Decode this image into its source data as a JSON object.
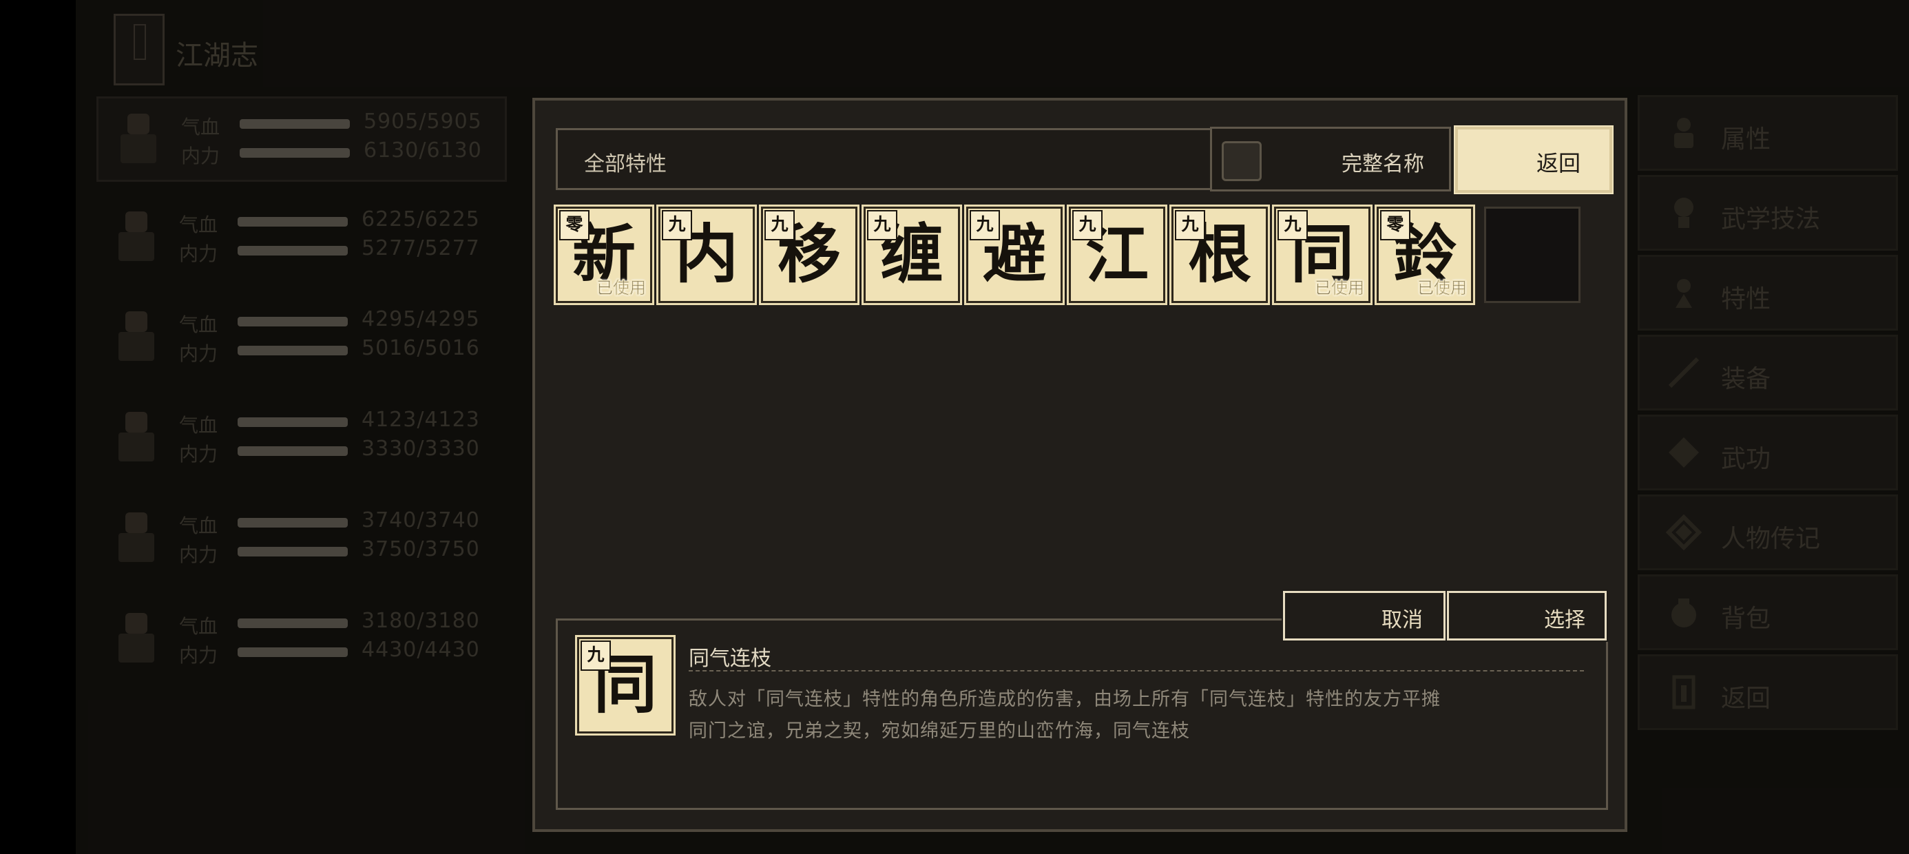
{
  "background": {
    "section_title": "江湖志",
    "characters": [
      {
        "hp_label": "气血",
        "hp": "5905/5905",
        "mp_label": "内力",
        "mp": "6130/6130",
        "selected": true
      },
      {
        "hp_label": "气血",
        "hp": "6225/6225",
        "mp_label": "内力",
        "mp": "5277/5277"
      },
      {
        "hp_label": "气血",
        "hp": "4295/4295",
        "mp_label": "内力",
        "mp": "5016/5016"
      },
      {
        "hp_label": "气血",
        "hp": "4123/4123",
        "mp_label": "内力",
        "mp": "3330/3330"
      },
      {
        "hp_label": "气血",
        "hp": "3740/3740",
        "mp_label": "内力",
        "mp": "3750/3750"
      },
      {
        "hp_label": "气血",
        "hp": "3180/3180",
        "mp_label": "内力",
        "mp": "4430/4430"
      }
    ],
    "side_menu": [
      {
        "label": "属性",
        "icon": "figure-icon"
      },
      {
        "label": "武学技法",
        "icon": "skill-icon"
      },
      {
        "label": "特性",
        "icon": "trait-icon"
      },
      {
        "label": "装备",
        "icon": "sword-icon"
      },
      {
        "label": "武功",
        "icon": "manual-icon"
      },
      {
        "label": "人物传记",
        "icon": "biography-icon"
      },
      {
        "label": "背包",
        "icon": "bag-icon"
      },
      {
        "label": "返回",
        "icon": "door-icon"
      }
    ]
  },
  "modal": {
    "filter_label": "全部特性",
    "full_name_label": "完整名称",
    "back_label": "返回",
    "cards": [
      {
        "char": "新",
        "grade": "零",
        "used": "已使用"
      },
      {
        "char": "内",
        "grade": "九",
        "used": ""
      },
      {
        "char": "移",
        "grade": "九",
        "used": ""
      },
      {
        "char": "缠",
        "grade": "九",
        "used": ""
      },
      {
        "char": "避",
        "grade": "九",
        "used": ""
      },
      {
        "char": "江",
        "grade": "九",
        "used": ""
      },
      {
        "char": "根",
        "grade": "九",
        "used": ""
      },
      {
        "char": "同",
        "grade": "九",
        "used": "已使用"
      },
      {
        "char": "鈴",
        "grade": "零",
        "used": "已使用"
      }
    ],
    "cancel_label": "取消",
    "choose_label": "选择",
    "detail": {
      "char": "同",
      "grade": "九",
      "title": "同气连枝",
      "effect": "敌人对「同气连枝」特性的角色所造成的伤害，由场上所有「同气连枝」特性的友方平摊",
      "flavor": "同门之谊，兄弟之契，宛如绵延万里的山峦竹海，同气连枝"
    }
  },
  "colors": {
    "card_bg": "#f0e2b6",
    "panel_bg": "#211e1a",
    "border": "#5f574a",
    "accent_button": "#f1e4bd"
  }
}
